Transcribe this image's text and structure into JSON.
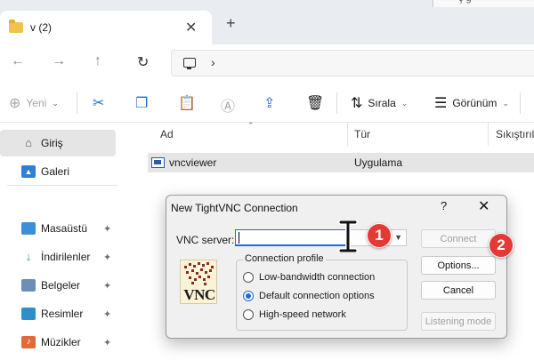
{
  "window": {
    "tab_title": "v (2)",
    "tab_close": "✕",
    "new_tab": "+",
    "top_right_fragment": "ç g"
  },
  "nav": {
    "back": "←",
    "forward": "→",
    "up": "↑",
    "refresh": "↻",
    "address_chevron": "›"
  },
  "toolbar": {
    "new_label": "Yeni",
    "sort_label": "Sırala",
    "view_label": "Görünüm",
    "dropdown_glyph": "⌄"
  },
  "sidebar": {
    "items": [
      {
        "label": "Giriş",
        "icon": "home-icon"
      },
      {
        "label": "Galeri",
        "icon": "gallery-icon"
      },
      {
        "label": "Masaüstü",
        "icon": "desktop-icon"
      },
      {
        "label": "İndirilenler",
        "icon": "download-icon"
      },
      {
        "label": "Belgeler",
        "icon": "documents-icon"
      },
      {
        "label": "Resimler",
        "icon": "pictures-icon"
      },
      {
        "label": "Müzikler",
        "icon": "music-icon"
      }
    ],
    "pin_glyph": "📌"
  },
  "files": {
    "columns": [
      "Ad",
      "Tür",
      "Sıkıştırılı"
    ],
    "rows": [
      {
        "name": "vncviewer",
        "type": "Uygulama"
      }
    ]
  },
  "dialog": {
    "title": "New TightVNC Connection",
    "help": "?",
    "close": "✕",
    "server_label": "VNC server:",
    "server_value": "",
    "logo_text": "VNC",
    "profile_legend": "Connection profile",
    "profile_options": [
      {
        "label": "Low-bandwidth connection",
        "selected": false
      },
      {
        "label": "Default connection options",
        "selected": true
      },
      {
        "label": "High-speed network",
        "selected": false
      }
    ],
    "buttons": {
      "connect": "Connect",
      "options": "Options...",
      "cancel": "Cancel",
      "listening": "Listening mode"
    }
  },
  "annotations": {
    "marker_1": "1",
    "marker_2": "2"
  },
  "colors": {
    "accent": "#1e6bd6",
    "marker": "#e53935",
    "folder": "#f2c34c"
  }
}
